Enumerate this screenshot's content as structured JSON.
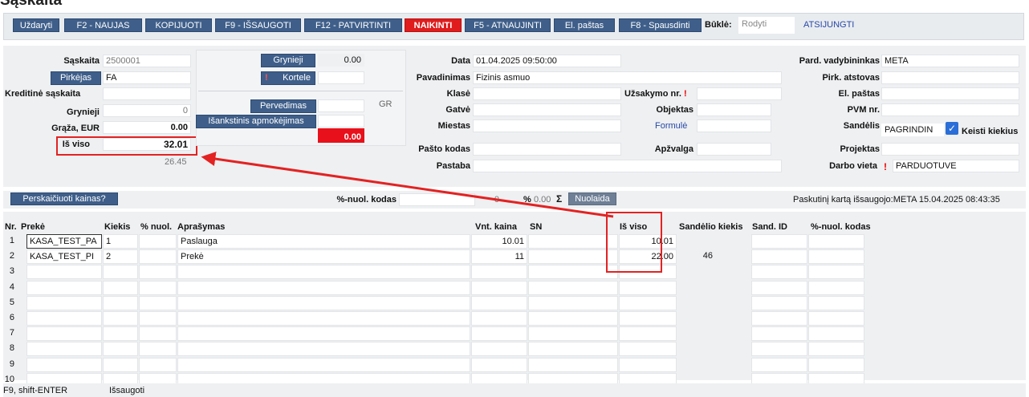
{
  "page_title": "Sąskaita",
  "toolbar": {
    "buttons": [
      "Uždaryti",
      "F2 - NAUJAS",
      "KOPIJUOTI",
      "F9 - IŠSAUGOTI",
      "F12 - PATVIRTINTI",
      "NAIKINTI",
      "F5 - ATNAUJINTI",
      "El. paštas",
      "F8 - Spausdinti"
    ],
    "state_label": "Būklė:",
    "state_value": "Rodyti",
    "disconnected": "ATSIJUNGTI"
  },
  "left": {
    "invoice_label": "Sąskaita",
    "invoice_value": "2500001",
    "buyer_button": "Pirkėjas",
    "buyer_value": "FA",
    "credit_label": "Kreditinė sąskaita",
    "cash_label": "Grynieji",
    "cash_value": "0",
    "change_label": "Grąža, EUR",
    "change_value": "0.00",
    "total_label": "Iš viso",
    "total_value": "32.01",
    "sub_value": "26.45"
  },
  "payments": {
    "cash_button": "Grynieji",
    "cash_value": "0.00",
    "card_button": "Kortele",
    "transfer_button": "Pervedimas",
    "transfer_code": "GR",
    "prepay_button": "Išankstinis apmokėjimas",
    "remaining": "0.00"
  },
  "middle": {
    "date_label": "Data",
    "date_value": "01.04.2025 09:50:00",
    "name_label": "Pavadinimas",
    "name_value": "Fizinis asmuo",
    "class_label": "Klasė",
    "street_label": "Gatvė",
    "city_label": "Miestas",
    "postcode_label": "Pašto kodas",
    "note_label": "Pastaba",
    "order_label": "Užsakymo nr.",
    "order_excl": "!",
    "object_label": "Objektas",
    "formula_link": "Formulė",
    "review_label": "Apžvalga"
  },
  "right": {
    "seller_label": "Pard. vadybininkas",
    "seller_value": "META",
    "buyer_rep_label": "Pirk. atstovas",
    "email_label": "El. paštas",
    "vat_label": "PVM nr.",
    "warehouse_label": "Sandėlis",
    "warehouse_value": "PAGRINDIN",
    "change_qty_label": "Keisti kiekius",
    "project_label": "Projektas",
    "workplace_label": "Darbo vieta",
    "workplace_excl": "!",
    "workplace_value": "PARDUOTUVE"
  },
  "recalc": {
    "button": "Perskaičiuoti kainas?",
    "disc_code_label": "%-nuol. kodas",
    "disc_value": "0",
    "pct_label": "%",
    "pct_value": "0.00",
    "sigma": "Σ",
    "discount_button": "Nuolaida",
    "last_saved": "Paskutinį kartą išsaugojo:META 15.04.2025 08:43:35"
  },
  "table": {
    "headers": [
      "Nr.",
      "Prekė",
      "Kiekis",
      "% nuol.",
      "Aprašymas",
      "Vnt. kaina",
      "SN",
      "Iš viso",
      "Sandėlio kiekis",
      "Sand. ID",
      "%-nuol. kodas"
    ],
    "rows": [
      {
        "nr": "1",
        "item": "KASA_TEST_PA",
        "qty": "1",
        "desc": "Paslauga",
        "price": "10.01",
        "total": "10.01",
        "stock": ""
      },
      {
        "nr": "2",
        "item": "KASA_TEST_PI",
        "qty": "2",
        "desc": "Prekė",
        "price": "11",
        "total": "22.00",
        "stock": "46"
      },
      {
        "nr": "3",
        "item": "",
        "qty": "",
        "desc": "",
        "price": "",
        "total": "",
        "stock": ""
      },
      {
        "nr": "4",
        "item": "",
        "qty": "",
        "desc": "",
        "price": "",
        "total": "",
        "stock": ""
      },
      {
        "nr": "5",
        "item": "",
        "qty": "",
        "desc": "",
        "price": "",
        "total": "",
        "stock": ""
      },
      {
        "nr": "6",
        "item": "",
        "qty": "",
        "desc": "",
        "price": "",
        "total": "",
        "stock": ""
      },
      {
        "nr": "7",
        "item": "",
        "qty": "",
        "desc": "",
        "price": "",
        "total": "",
        "stock": ""
      },
      {
        "nr": "8",
        "item": "",
        "qty": "",
        "desc": "",
        "price": "",
        "total": "",
        "stock": ""
      },
      {
        "nr": "9",
        "item": "",
        "qty": "",
        "desc": "",
        "price": "",
        "total": "",
        "stock": ""
      },
      {
        "nr": "10",
        "item": "",
        "qty": "",
        "desc": "",
        "price": "",
        "total": "",
        "stock": ""
      }
    ]
  },
  "footer": {
    "shortcut": "F9, shift-ENTER",
    "action": "Išsaugoti"
  },
  "colors": {
    "button_blue": "#3f5f8a",
    "delete_red": "#e01c1c",
    "highlight_red": "#e32222",
    "panel_gray": "#eef0f2"
  }
}
